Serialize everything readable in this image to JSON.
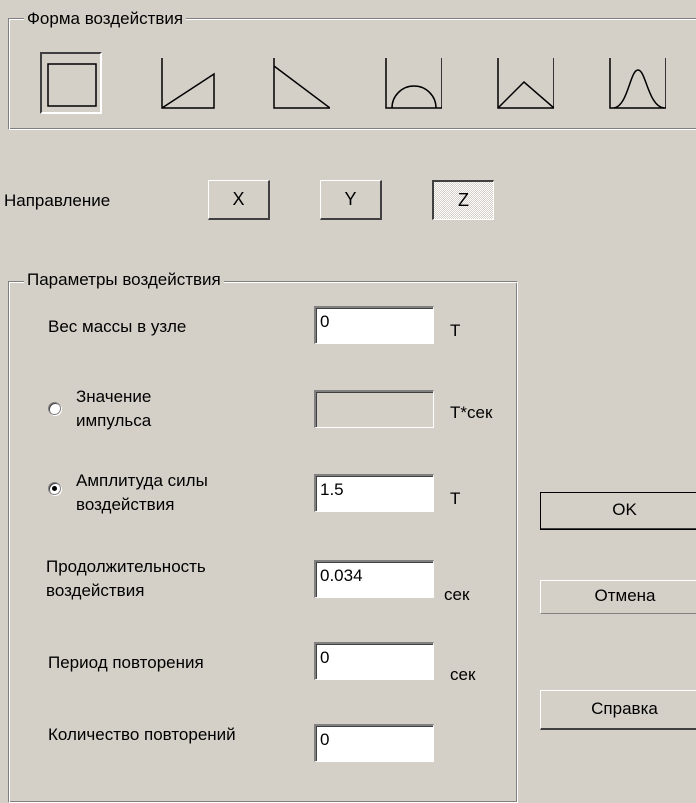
{
  "shape_group": {
    "title": "Форма воздействия",
    "buttons": [
      {
        "icon": "rectangle-pulse-icon",
        "pressed": true
      },
      {
        "icon": "ramp-up-pulse-icon",
        "pressed": false
      },
      {
        "icon": "ramp-down-pulse-icon",
        "pressed": false
      },
      {
        "icon": "half-sine-pulse-icon",
        "pressed": false
      },
      {
        "icon": "triangle-pulse-icon",
        "pressed": false
      },
      {
        "icon": "bell-pulse-icon",
        "pressed": false
      }
    ]
  },
  "direction": {
    "label": "Направление",
    "buttons": [
      {
        "label": "X",
        "pressed": false
      },
      {
        "label": "Y",
        "pressed": false
      },
      {
        "label": "Z",
        "pressed": true
      }
    ]
  },
  "params_group": {
    "title": "Параметры воздействия",
    "mass": {
      "label": "Вес массы в узле",
      "value": "0",
      "unit": "Т"
    },
    "impulse": {
      "label_line1": "Значение",
      "label_line2": "импульса",
      "value": "",
      "unit": "Т*сек",
      "selected": false
    },
    "amplitude": {
      "label_line1": "Амплитуда силы",
      "label_line2": "воздействия",
      "value": "1.5",
      "unit": "Т",
      "selected": true
    },
    "duration": {
      "label_line1": "Продолжительность",
      "label_line2": "воздействия",
      "value": "0.034",
      "unit": "сек"
    },
    "period": {
      "label": "Период повторения",
      "value": "0",
      "unit": "сек"
    },
    "count": {
      "label": "Количество повторений",
      "value": "0"
    }
  },
  "buttons": {
    "ok": "OK",
    "cancel": "Отмена",
    "help": "Справка"
  },
  "colors": {
    "face": "#d4d0c8",
    "shadow": "#808080",
    "dark_shadow": "#404040",
    "highlight": "#ffffff"
  }
}
